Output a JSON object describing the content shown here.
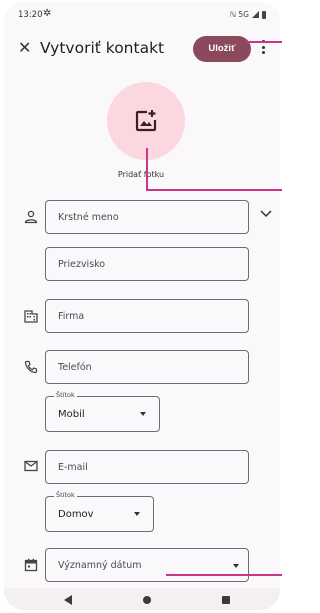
{
  "status_bar": {
    "time": "13:20",
    "network": "ℕ 5G"
  },
  "app_bar": {
    "title": "Vytvoriť kontakt",
    "save_label": "Uložiť"
  },
  "photo": {
    "label": "Pridať fotku"
  },
  "fields": {
    "first_name": "Krstné meno",
    "last_name": "Priezvisko",
    "company": "Firma",
    "phone": "Telefón",
    "phone_label": {
      "label": "Štítok",
      "value": "Mobil"
    },
    "email": "E-mail",
    "email_label": {
      "label": "Štítok",
      "value": "Domov"
    },
    "significant_date": "Významný dátum"
  },
  "colors": {
    "accent": "#8b4a5c",
    "photo_bg": "#fbd8e0",
    "annotation": "#c8368c"
  }
}
